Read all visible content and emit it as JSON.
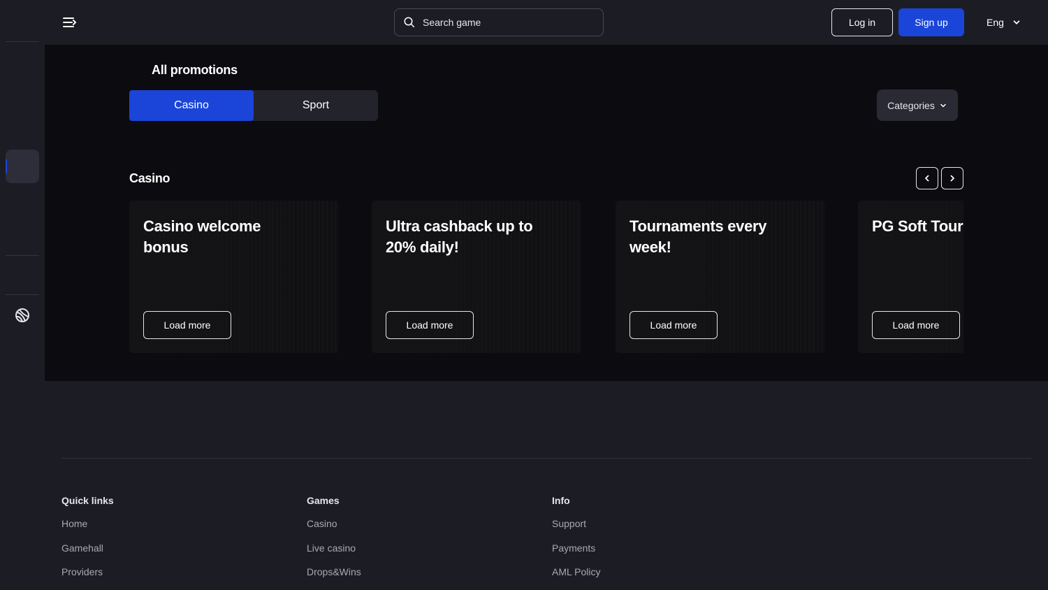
{
  "header": {
    "search_placeholder": "Search game",
    "login_label": "Log in",
    "signup_label": "Sign up",
    "language": "Eng"
  },
  "main": {
    "page_title": "All promotions",
    "tabs": [
      {
        "label": "Casino",
        "active": true
      },
      {
        "label": "Sport",
        "active": false
      }
    ],
    "categories_label": "Categories",
    "section_title": "Casino",
    "cards": [
      {
        "title": "Casino welcome bonus",
        "button": "Load more"
      },
      {
        "title": "Ultra cashback up to 20% daily!",
        "button": "Load more"
      },
      {
        "title": "Tournaments every week!",
        "button": "Load more"
      },
      {
        "title": "PG Soft Tourı",
        "button": "Load more"
      }
    ]
  },
  "footer": {
    "columns": [
      {
        "heading": "Quick links",
        "links": [
          "Home",
          "Gamehall",
          "Providers"
        ]
      },
      {
        "heading": "Games",
        "links": [
          "Casino",
          "Live casino",
          "Drops&Wins"
        ]
      },
      {
        "heading": "Info",
        "links": [
          "Support",
          "Payments",
          "AML Policy"
        ]
      }
    ]
  },
  "colors": {
    "accent": "#1a45d8",
    "background": "#1c1c24",
    "main_background": "#0c0c10"
  },
  "icons": {
    "menu": "menu-arrow-icon",
    "search": "search-icon",
    "chevron": "chevron-down-icon",
    "globe": "globe-icon",
    "prev": "chevron-left-icon",
    "next": "chevron-right-icon"
  }
}
